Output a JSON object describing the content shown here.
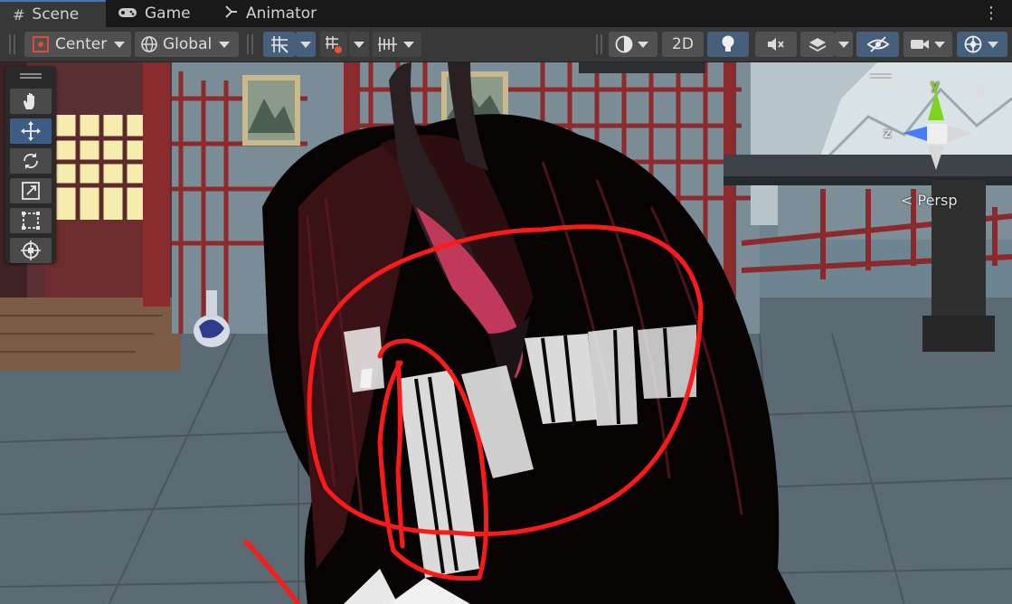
{
  "tabs": [
    {
      "label": "Scene",
      "icon": "hash-icon",
      "active": true
    },
    {
      "label": "Game",
      "icon": "gamepad-icon",
      "active": false
    },
    {
      "label": "Animator",
      "icon": "animator-icon",
      "active": false
    }
  ],
  "toolbar": {
    "pivot_label": "Center",
    "space_label": "Global",
    "mode_2d_label": "2D"
  },
  "gizmo": {
    "y_label": "y",
    "z_label": "z",
    "projection_label": "< Persp"
  },
  "colors": {
    "accent": "#3a79bb",
    "active_button": "#46607c",
    "annotation": "#ff1a1a",
    "axis_y": "#7ed321",
    "axis_z": "#4a7bff"
  },
  "palette_tools": [
    "hand-tool",
    "move-tool",
    "rotate-tool",
    "scale-tool",
    "rect-tool",
    "transform-tool"
  ]
}
